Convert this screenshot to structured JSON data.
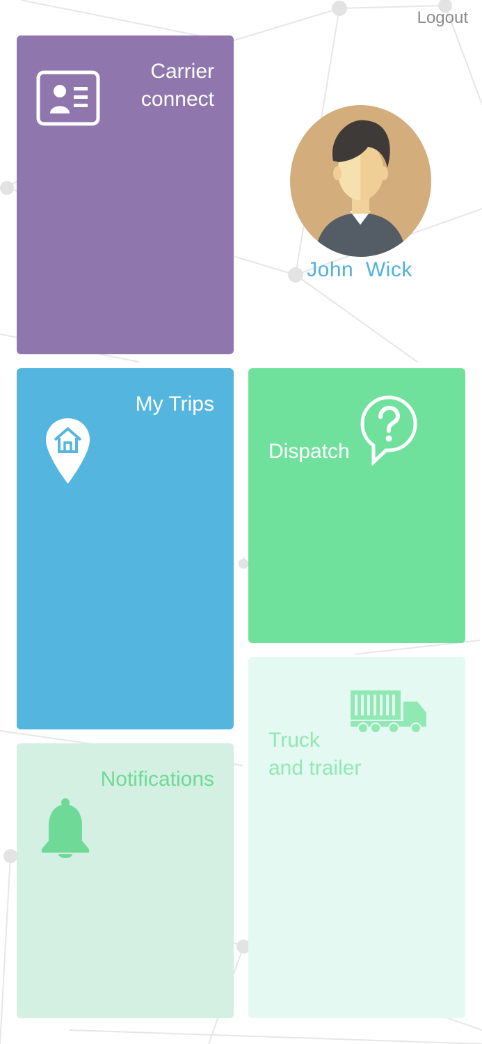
{
  "header": {
    "logout_label": "Logout"
  },
  "profile": {
    "name": "John  Wick",
    "avatar_icon": "user-avatar"
  },
  "tiles": [
    {
      "id": "carrier_connect",
      "label": "Carrier\nconnect",
      "icon": "id-card-icon",
      "color": "#8f77ae"
    },
    {
      "id": "my_trips",
      "label": "My Trips",
      "icon": "home-pin-icon",
      "color": "#54b6de"
    },
    {
      "id": "dispatch",
      "label": "Dispatch",
      "icon": "question-bubble-icon",
      "color": "#70e19c"
    },
    {
      "id": "truck_and_trailer",
      "label": "Truck\nand trailer",
      "icon": "truck-icon",
      "color": "#e5f9f3"
    },
    {
      "id": "notifications",
      "label": "Notifications",
      "icon": "bell-icon",
      "color": "#d3f0e2"
    }
  ]
}
